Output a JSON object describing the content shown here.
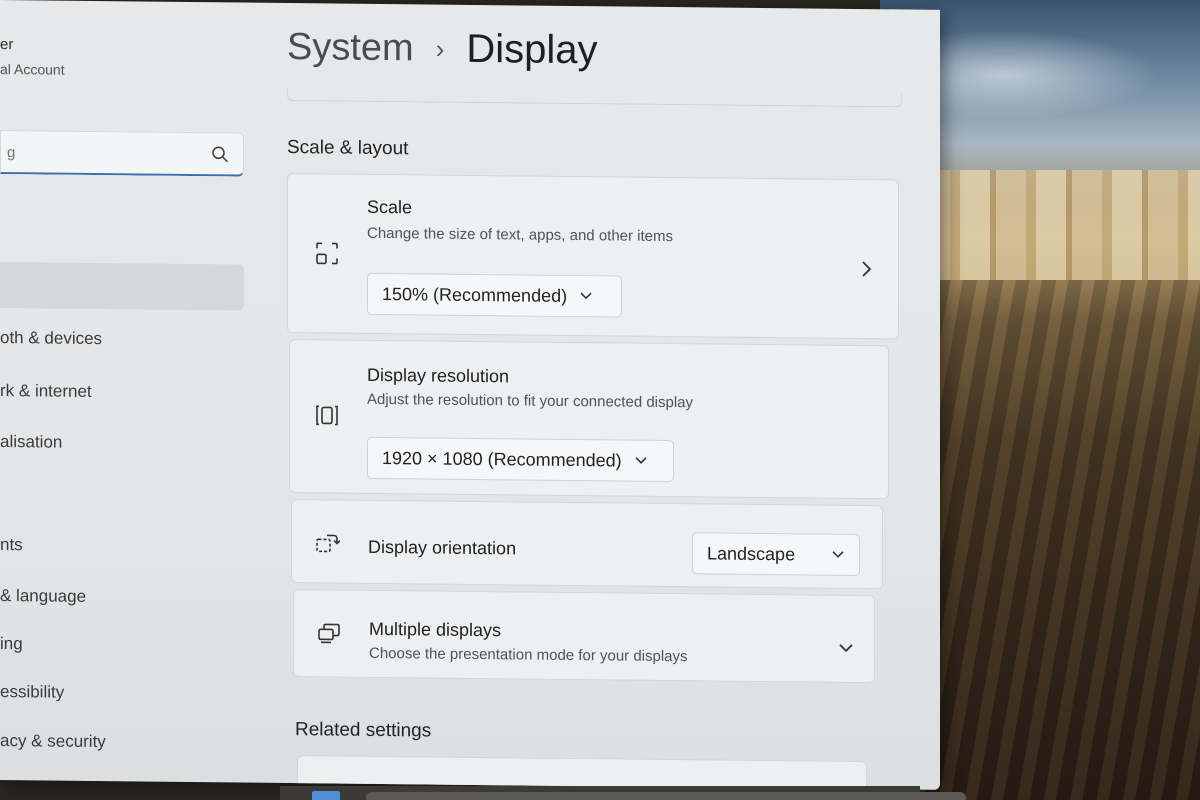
{
  "sidebar": {
    "account_name": "er",
    "account_type": "al Account",
    "search_placeholder": "g",
    "items": [
      {
        "label": "oth & devices"
      },
      {
        "label": "rk & internet"
      },
      {
        "label": "alisation"
      },
      {
        "label": "nts"
      },
      {
        "label": "& language"
      },
      {
        "label": "ing"
      },
      {
        "label": "essibility"
      },
      {
        "label": "acy & security"
      }
    ]
  },
  "header": {
    "parent": "System",
    "separator": "›",
    "current": "Display"
  },
  "scale_layout": {
    "section_title": "Scale & layout",
    "scale": {
      "title": "Scale",
      "description": "Change the size of text, apps, and other items",
      "value": "150% (Recommended)"
    },
    "resolution": {
      "title": "Display resolution",
      "description": "Adjust the resolution to fit your connected display",
      "value": "1920 × 1080 (Recommended)"
    },
    "orientation": {
      "title": "Display orientation",
      "value": "Landscape"
    },
    "multiple": {
      "title": "Multiple displays",
      "description": "Choose the presentation mode for your displays"
    }
  },
  "related": {
    "section_title": "Related settings"
  },
  "icons": {
    "search": "search-icon",
    "scale": "scale-icon",
    "resolution": "resolution-icon",
    "orientation": "orientation-icon",
    "multiple": "multiple-displays-icon"
  },
  "colors": {
    "accent": "#3c6fb0",
    "window_bg": "#e6e8ea",
    "card_bg": "#edeff0"
  }
}
